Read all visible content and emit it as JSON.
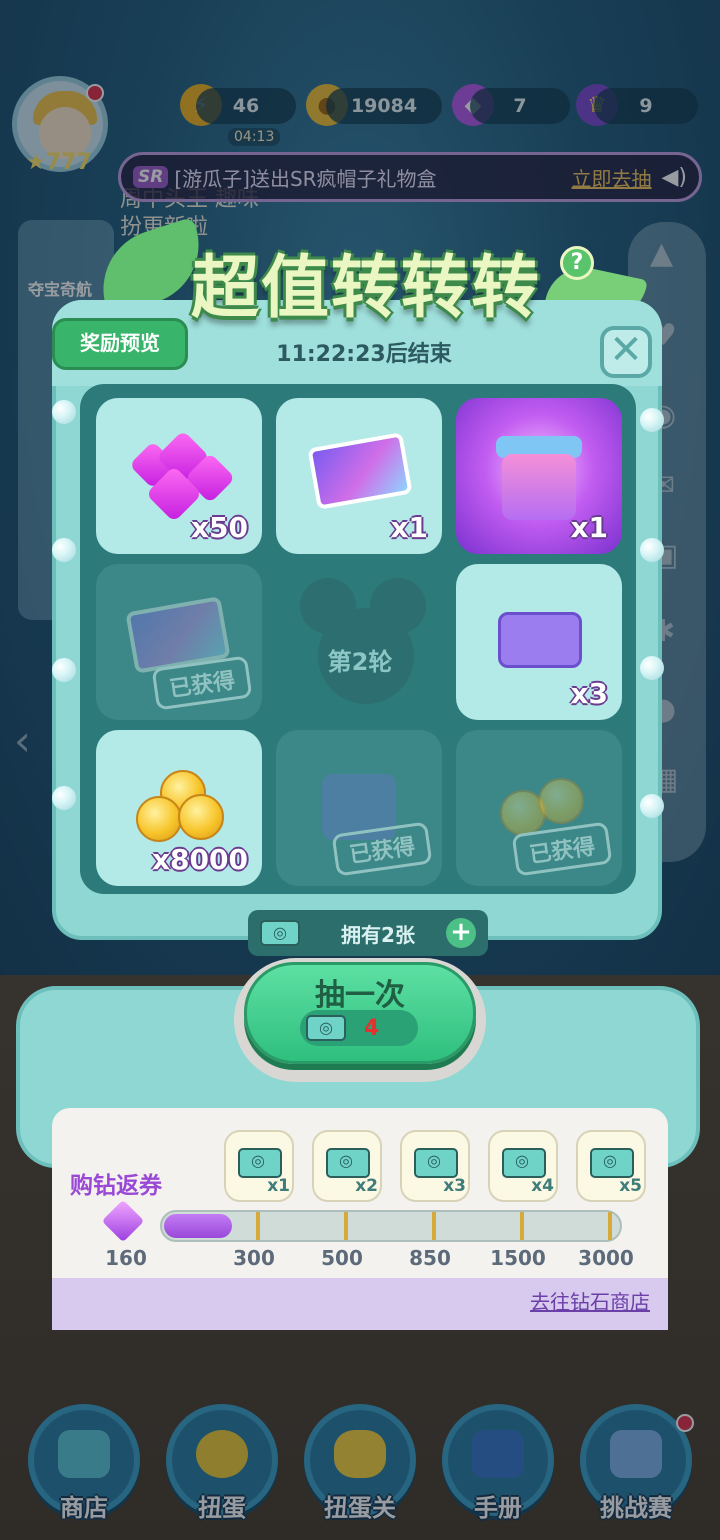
{
  "hud": {
    "level": "777",
    "energy": "46",
    "energy_timer": "04:13",
    "coins": "19084",
    "gems": "7",
    "crowns": "9"
  },
  "ticker": {
    "badge": "SR",
    "message": "[游瓜子]送出SR疯帽子礼物盒",
    "action": "立即去抽"
  },
  "background_text": {
    "notice": "周中头王 趣味\n扮更新啦",
    "left_label": "夺宝奇航"
  },
  "panel": {
    "title": "超值转转转",
    "help": "?",
    "preview_button": "奖励预览",
    "timer": "11:22:23后结束",
    "close": "✕"
  },
  "grid": {
    "cells": [
      {
        "name": "gems",
        "qty": "x50",
        "state": "available"
      },
      {
        "name": "mickey-card",
        "qty": "x1",
        "state": "available"
      },
      {
        "name": "sr-gift-box",
        "qty": "x1",
        "state": "featured"
      },
      {
        "name": "mickey-card",
        "qty": "",
        "state": "obtained",
        "status_label": "已获得"
      },
      {
        "name": "round-indicator",
        "label": "第2轮"
      },
      {
        "name": "scan-ticket",
        "qty": "x3",
        "state": "available"
      },
      {
        "name": "coins",
        "qty": "x8000",
        "state": "available"
      },
      {
        "name": "gift-box",
        "qty": "",
        "state": "obtained",
        "status_label": "已获得"
      },
      {
        "name": "coins",
        "qty": "",
        "state": "obtained",
        "status_label": "已获得"
      }
    ]
  },
  "owned": {
    "label": "拥有2张"
  },
  "draw": {
    "label": "抽一次",
    "cost": "4"
  },
  "rebate": {
    "title": "购钻返券",
    "current": "160",
    "progress_fraction": 0.15,
    "tiers": [
      {
        "amount": "300",
        "reward": "x1"
      },
      {
        "amount": "500",
        "reward": "x2"
      },
      {
        "amount": "850",
        "reward": "x3"
      },
      {
        "amount": "1500",
        "reward": "x4"
      },
      {
        "amount": "3000",
        "reward": "x5"
      }
    ],
    "store_link": "去往钻石商店"
  },
  "nav": [
    {
      "label": "商店"
    },
    {
      "label": "扭蛋"
    },
    {
      "label": "扭蛋关"
    },
    {
      "label": "手册"
    },
    {
      "label": "挑战赛"
    }
  ],
  "colors": {
    "machine": "#8fd7d3",
    "grid_bg": "#2c7a7a",
    "featured": "#c25df1",
    "draw_button": "#2fbf7e",
    "rebate_accent": "#9a48d9"
  }
}
